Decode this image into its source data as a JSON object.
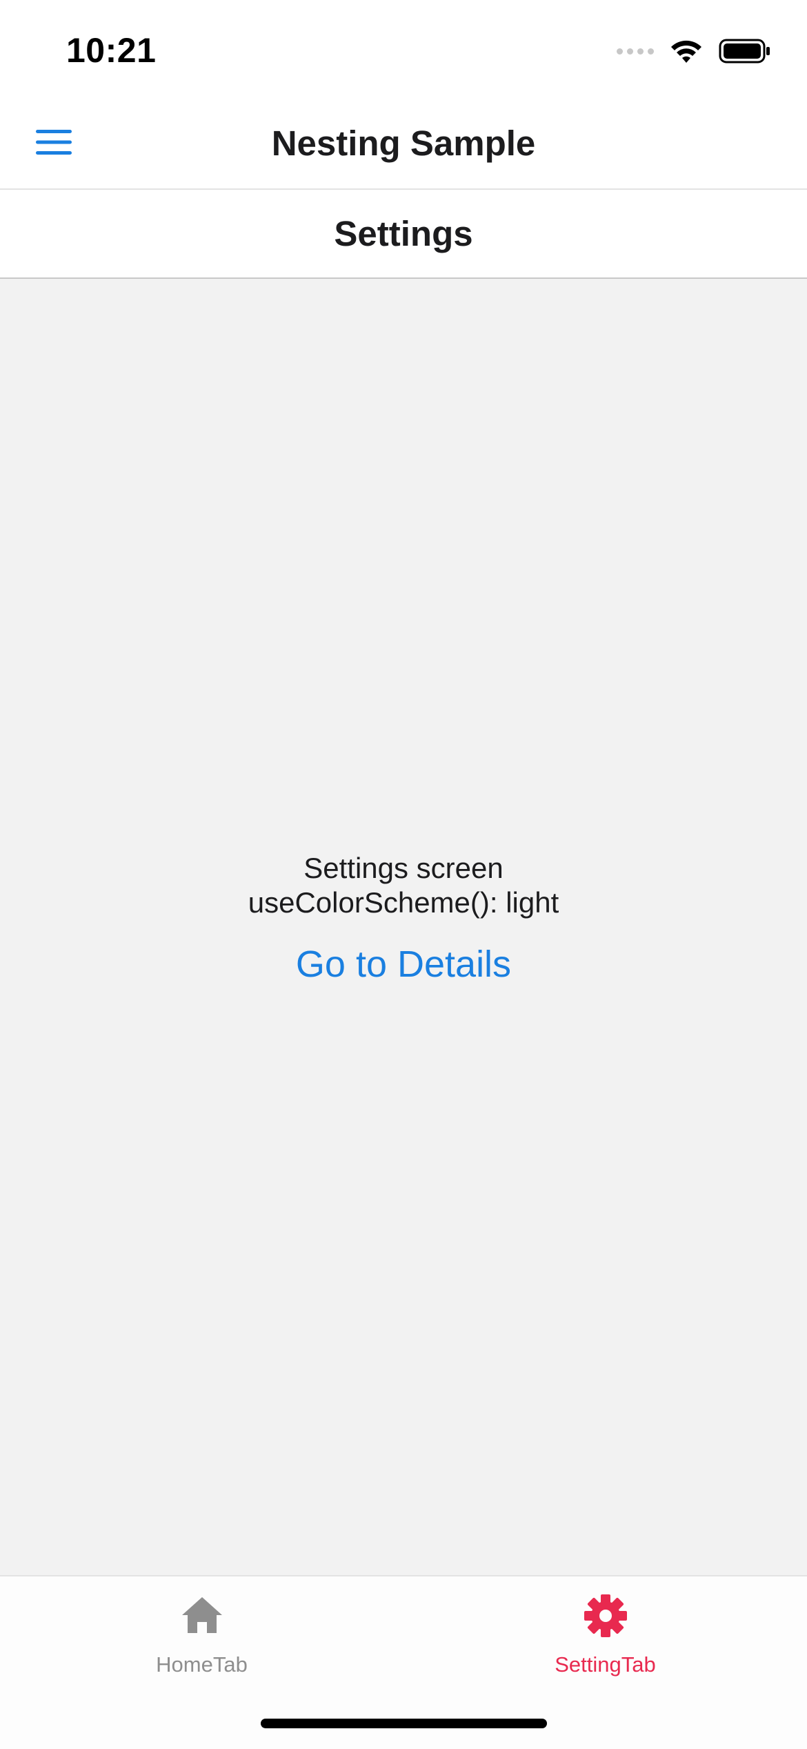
{
  "status_bar": {
    "time": "10:21"
  },
  "header": {
    "title": "Nesting Sample",
    "menu_icon": "hamburger-menu-icon"
  },
  "tab_header": {
    "title": "Settings"
  },
  "screen": {
    "line1": "Settings screen",
    "line2": "useColorScheme(): light",
    "details_link": "Go to Details"
  },
  "tab_bar": {
    "tabs": [
      {
        "label": "HomeTab",
        "icon": "home-icon",
        "active": false
      },
      {
        "label": "SettingTab",
        "icon": "gear-icon",
        "active": true
      }
    ]
  },
  "colors": {
    "accent_blue": "#1a7fe0",
    "active_tab": "#e8294f",
    "inactive_tab": "#8e8e8e",
    "background": "#f2f2f2"
  }
}
